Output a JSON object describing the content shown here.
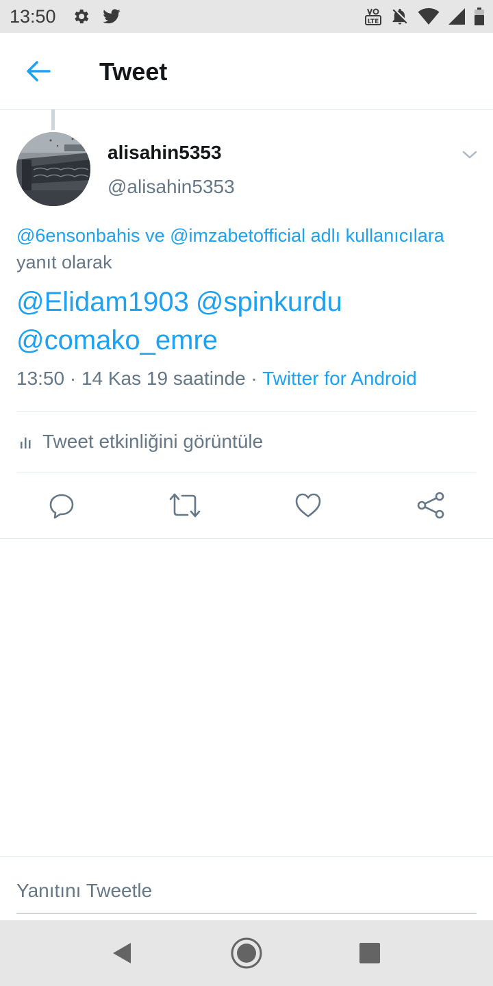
{
  "status_bar": {
    "time": "13:50",
    "left_icons": [
      "gear-icon",
      "twitter-bird-icon"
    ],
    "right_icons": [
      "volte-icon",
      "notifications-off-icon",
      "wifi-icon",
      "signal-icon",
      "battery-icon"
    ]
  },
  "header": {
    "title": "Tweet",
    "back_icon": "arrow-left-icon"
  },
  "tweet": {
    "display_name": "alisahin5353",
    "username": "@alisahin5353",
    "reply_context": {
      "mention_1": "@6ensonbahis",
      "connector": "ve",
      "mention_2": "@imzabetofficial",
      "suffix_link": "adlı kullanıcılara",
      "suffix_text": "yanıt olarak"
    },
    "text_mentions": [
      "@Elidam1903",
      "@spinkurdu",
      "@comako_emre"
    ],
    "timestamp": "13:50 · 14 Kas 19 saatinde · ",
    "source": "Twitter for Android"
  },
  "activity": {
    "label": "Tweet etkinliğini görüntüle",
    "icon": "bar-chart-icon"
  },
  "actions": [
    {
      "name": "reply-button",
      "icon": "reply-icon"
    },
    {
      "name": "retweet-button",
      "icon": "retweet-icon"
    },
    {
      "name": "like-button",
      "icon": "heart-icon"
    },
    {
      "name": "share-button",
      "icon": "share-icon"
    }
  ],
  "reply_composer": {
    "placeholder": "Yanıtını Tweetle"
  },
  "nav_bar": {
    "buttons": [
      "back-triangle-icon",
      "home-circle-icon",
      "recents-square-icon"
    ]
  },
  "colors": {
    "accent": "#1da1f2",
    "secondary_text": "#657786",
    "divider": "#e1e8ed",
    "system_bar": "#e6e6e6"
  }
}
